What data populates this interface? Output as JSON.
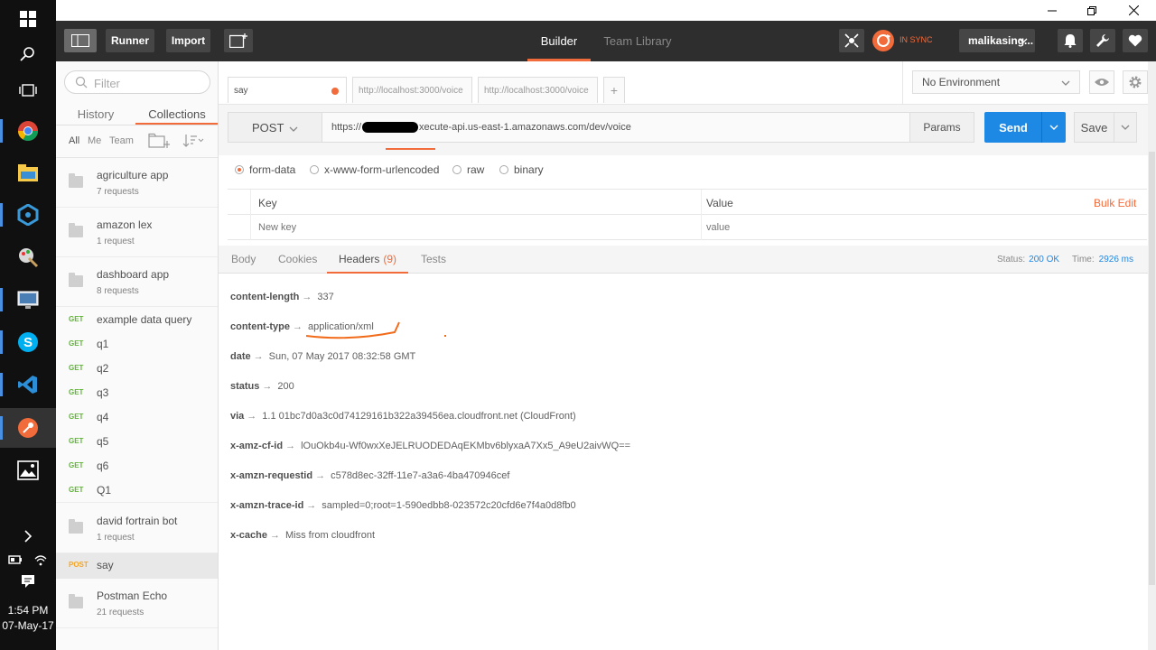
{
  "taskbar": {
    "time": "1:54 PM",
    "date": "07-May-17"
  },
  "header": {
    "runner_label": "Runner",
    "import_label": "Import",
    "builder_tab": "Builder",
    "team_library_tab": "Team Library",
    "sync_status": "IN SYNC",
    "user_name": "malikasing...",
    "accent_color": "#f26b3a"
  },
  "sidebar": {
    "filter_placeholder": "Filter",
    "tabs": [
      "History",
      "Collections"
    ],
    "filters": [
      "All",
      "Me",
      "Team"
    ],
    "collections_top": [
      {
        "name": "agriculture app",
        "count": "7 requests"
      },
      {
        "name": "amazon lex",
        "count": "1 request"
      },
      {
        "name": "dashboard app",
        "count": "8 requests"
      }
    ],
    "requests": [
      {
        "method": "GET",
        "name": "example data query"
      },
      {
        "method": "GET",
        "name": "q1"
      },
      {
        "method": "GET",
        "name": "q2"
      },
      {
        "method": "GET",
        "name": "q3"
      },
      {
        "method": "GET",
        "name": "q4"
      },
      {
        "method": "GET",
        "name": "q5"
      },
      {
        "method": "GET",
        "name": "q6"
      },
      {
        "method": "GET",
        "name": "Q1"
      }
    ],
    "collection_after": {
      "name": "david fortrain bot",
      "count": "1 request"
    },
    "selected_request": {
      "method": "POST",
      "name": "say"
    },
    "collection_last": {
      "name": "Postman Echo",
      "count": "21 requests"
    }
  },
  "request_tabs": [
    "say",
    "http://localhost:3000/voice",
    "http://localhost:3000/voice"
  ],
  "environment": "No Environment",
  "request": {
    "method": "POST",
    "url_prefix": "https://",
    "url_suffix": "xecute-api.us-east-1.amazonaws.com/dev/voice",
    "params_label": "Params",
    "send_label": "Send",
    "save_label": "Save"
  },
  "body_types": [
    "form-data",
    "x-www-form-urlencoded",
    "raw",
    "binary"
  ],
  "kv_table": {
    "key_header": "Key",
    "value_header": "Value",
    "bulk_edit": "Bulk Edit",
    "key_placeholder": "New key",
    "value_placeholder": "value"
  },
  "response": {
    "tabs": [
      "Body",
      "Cookies",
      "Headers",
      "Tests"
    ],
    "headers_count": "(9)",
    "status_label": "Status:",
    "status_value": "200 OK",
    "time_label": "Time:",
    "time_value": "2926 ms",
    "headers": [
      {
        "key": "content-length",
        "value": "337"
      },
      {
        "key": "content-type",
        "value": "application/xml"
      },
      {
        "key": "date",
        "value": "Sun, 07 May 2017 08:32:58 GMT"
      },
      {
        "key": "status",
        "value": "200"
      },
      {
        "key": "via",
        "value": "1.1 01bc7d0a3c0d74129161b322a39456ea.cloudfront.net (CloudFront)"
      },
      {
        "key": "x-amz-cf-id",
        "value": "lOuOkb4u-Wf0wxXeJELRUODEDAqEKMbv6blyxaA7Xx5_A9eU2aivWQ=="
      },
      {
        "key": "x-amzn-requestid",
        "value": "c578d8ec-32ff-11e7-a3a6-4ba470946cef"
      },
      {
        "key": "x-amzn-trace-id",
        "value": "sampled=0;root=1-590edbb8-023572c20cfd6e7f4a0d8fb0"
      },
      {
        "key": "x-cache",
        "value": "Miss from cloudfront"
      }
    ],
    "arrow": "→"
  }
}
